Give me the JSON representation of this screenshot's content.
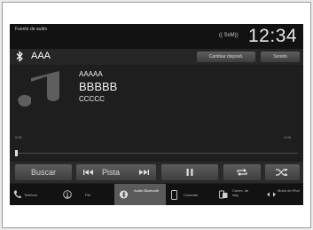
{
  "status_bar": {
    "source_label": "Fuente de audio",
    "signal_text": "(( SxM))",
    "clock": "12:34"
  },
  "header": {
    "device_name": "AAA",
    "change_device_button": "Cambiar disposit.",
    "sound_button": "Sonido"
  },
  "now_playing": {
    "album": "AAAAA",
    "track_title": "BBBBB",
    "artist": "CCCCC",
    "elapsed_time": "0:00",
    "remaining_time": "-2:00",
    "progress": 0.0
  },
  "controls": {
    "search_button": "Buscar",
    "track_label": "Pista"
  },
  "bottom_nav": [
    {
      "label": "Teléfono",
      "icon": "phone-icon",
      "active": false
    },
    {
      "label": "FM",
      "icon": "radio-tower-icon",
      "active": false
    },
    {
      "label": "Audio Bluetooth",
      "icon": "bluetooth-icon",
      "active": true
    },
    {
      "label": "Conectar",
      "icon": "phone-connect-icon",
      "active": false
    },
    {
      "label": "Conex. de seg.",
      "icon": "backup-connect-icon",
      "active": false
    },
    {
      "label": "Modo de iPod",
      "icon": "ipod-mode-icon",
      "active": false
    }
  ]
}
